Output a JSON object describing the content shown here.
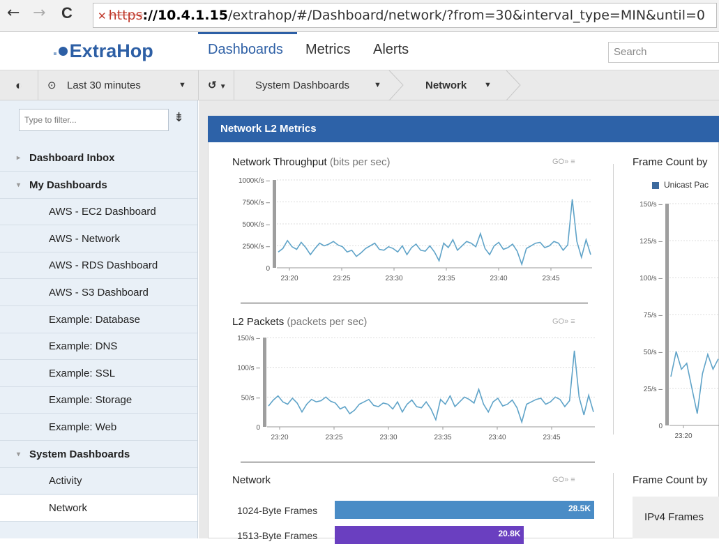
{
  "browser": {
    "back_icon": "←",
    "forward_icon": "→",
    "reload_icon": "C",
    "url_scheme": "https",
    "url_host": "://10.4.1.15",
    "url_path": "/extrahop/#/Dashboard/network/?from=30&interval_type=MIN&until=0"
  },
  "app": {
    "logo_text": "ExtraHop",
    "nav": [
      "Dashboards",
      "Metrics",
      "Alerts"
    ],
    "search_placeholder": "Search",
    "accent_color": "#2d62a8"
  },
  "toolbar": {
    "time_range": "Last 30 minutes",
    "crumb_1": "System Dashboards",
    "crumb_2": "Network"
  },
  "sidebar": {
    "filter_placeholder": "Type to filter...",
    "items": [
      {
        "label": "Dashboard Inbox",
        "type": "head",
        "arrow": "▸"
      },
      {
        "label": "My Dashboards",
        "type": "head",
        "arrow": "▾"
      },
      {
        "label": "AWS - EC2 Dashboard",
        "type": "child"
      },
      {
        "label": "AWS - Network",
        "type": "child"
      },
      {
        "label": "AWS - RDS Dashboard",
        "type": "child"
      },
      {
        "label": "AWS - S3 Dashboard",
        "type": "child"
      },
      {
        "label": "Example: Database",
        "type": "child"
      },
      {
        "label": "Example: DNS",
        "type": "child"
      },
      {
        "label": "Example: SSL",
        "type": "child"
      },
      {
        "label": "Example: Storage",
        "type": "child"
      },
      {
        "label": "Example: Web",
        "type": "child"
      },
      {
        "label": "System Dashboards",
        "type": "head",
        "arrow": "▾"
      },
      {
        "label": "Activity",
        "type": "child"
      },
      {
        "label": "Network",
        "type": "child",
        "selected": true
      }
    ]
  },
  "region": {
    "title": "Network L2 Metrics"
  },
  "chart_data": [
    {
      "type": "line",
      "title": "Network Throughput",
      "unit": "(bits per sec)",
      "tools": "GO»  ≡",
      "y_ticks": [
        "1000K/s",
        "750K/s",
        "500K/s",
        "250K/s",
        "0"
      ],
      "x_ticks": [
        "23:20",
        "23:25",
        "23:30",
        "23:35",
        "23:40",
        "23:45"
      ],
      "ylim": [
        0,
        1000
      ],
      "series": [
        {
          "values": [
            180,
            220,
            310,
            240,
            210,
            290,
            230,
            150,
            220,
            280,
            250,
            270,
            300,
            260,
            240,
            180,
            200,
            130,
            170,
            220,
            250,
            280,
            210,
            200,
            240,
            220,
            180,
            250,
            150,
            230,
            270,
            200,
            190,
            250,
            180,
            80,
            280,
            230,
            320,
            200,
            250,
            300,
            280,
            240,
            390,
            220,
            150,
            250,
            290,
            210,
            230,
            270,
            190,
            40,
            220,
            250,
            280,
            290,
            230,
            250,
            300,
            280,
            200,
            260,
            780,
            300,
            120,
            320,
            150
          ]
        }
      ]
    },
    {
      "type": "line",
      "title": "L2 Packets",
      "unit": "(packets per sec)",
      "tools": "GO»  ≡",
      "y_ticks": [
        "150/s",
        "100/s",
        "50/s",
        "0"
      ],
      "x_ticks": [
        "23:20",
        "23:25",
        "23:30",
        "23:35",
        "23:40",
        "23:45"
      ],
      "ylim": [
        0,
        150
      ],
      "series": [
        {
          "values": [
            35,
            45,
            52,
            42,
            38,
            48,
            40,
            25,
            38,
            46,
            42,
            44,
            50,
            43,
            40,
            30,
            34,
            22,
            28,
            38,
            42,
            46,
            36,
            34,
            40,
            38,
            30,
            42,
            25,
            38,
            45,
            34,
            32,
            42,
            30,
            12,
            46,
            38,
            52,
            34,
            42,
            50,
            46,
            40,
            63,
            38,
            25,
            42,
            48,
            35,
            38,
            45,
            32,
            8,
            38,
            42,
            46,
            48,
            38,
            42,
            50,
            46,
            34,
            44,
            128,
            50,
            20,
            53,
            25
          ]
        }
      ]
    },
    {
      "type": "line",
      "title": "Frame Count by",
      "legend": [
        "Unicast Pac"
      ],
      "y_ticks": [
        "150/s",
        "125/s",
        "100/s",
        "75/s",
        "50/s",
        "25/s",
        "0"
      ],
      "x_ticks": [
        "23:20"
      ],
      "ylim": [
        0,
        150
      ],
      "series": [
        {
          "values": [
            33,
            50,
            38,
            42,
            25,
            8,
            35,
            48,
            38,
            45
          ]
        }
      ]
    },
    {
      "type": "bar",
      "title": "Network",
      "tools": "GO»  ≡",
      "categories": [
        "1024-Byte Frames",
        "1513-Byte Frames"
      ],
      "values": [
        28.5,
        20.8
      ],
      "value_labels": [
        "28.5K",
        "20.8K"
      ],
      "colors": [
        "#4a8cc6",
        "#6a3fc0"
      ]
    },
    {
      "type": "table",
      "title": "Frame Count by",
      "rows": [
        "IPv4 Frames"
      ]
    }
  ]
}
